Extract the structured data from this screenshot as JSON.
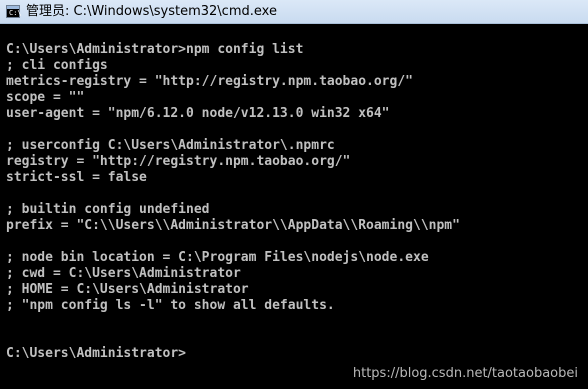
{
  "window": {
    "title": "管理员: C:\\Windows\\system32\\cmd.exe",
    "icon": "cmd-console-icon",
    "icon_prompt": "C:\\"
  },
  "console": {
    "lines": [
      "C:\\Users\\Administrator>npm config list",
      "; cli configs",
      "metrics-registry = \"http://registry.npm.taobao.org/\"",
      "scope = \"\"",
      "user-agent = \"npm/6.12.0 node/v12.13.0 win32 x64\"",
      "",
      "; userconfig C:\\Users\\Administrator\\.npmrc",
      "registry = \"http://registry.npm.taobao.org/\"",
      "strict-ssl = false",
      "",
      "; builtin config undefined",
      "prefix = \"C:\\\\Users\\\\Administrator\\\\AppData\\\\Roaming\\\\npm\"",
      "",
      "; node bin location = C:\\Program Files\\nodejs\\node.exe",
      "; cwd = C:\\Users\\Administrator",
      "; HOME = C:\\Users\\Administrator",
      "; \"npm config ls -l\" to show all defaults.",
      "",
      "",
      "C:\\Users\\Administrator>"
    ],
    "text_color": "#c0c0c0",
    "background_color": "#000000"
  },
  "watermark": {
    "text": "https://blog.csdn.net/taotaobaobei"
  }
}
